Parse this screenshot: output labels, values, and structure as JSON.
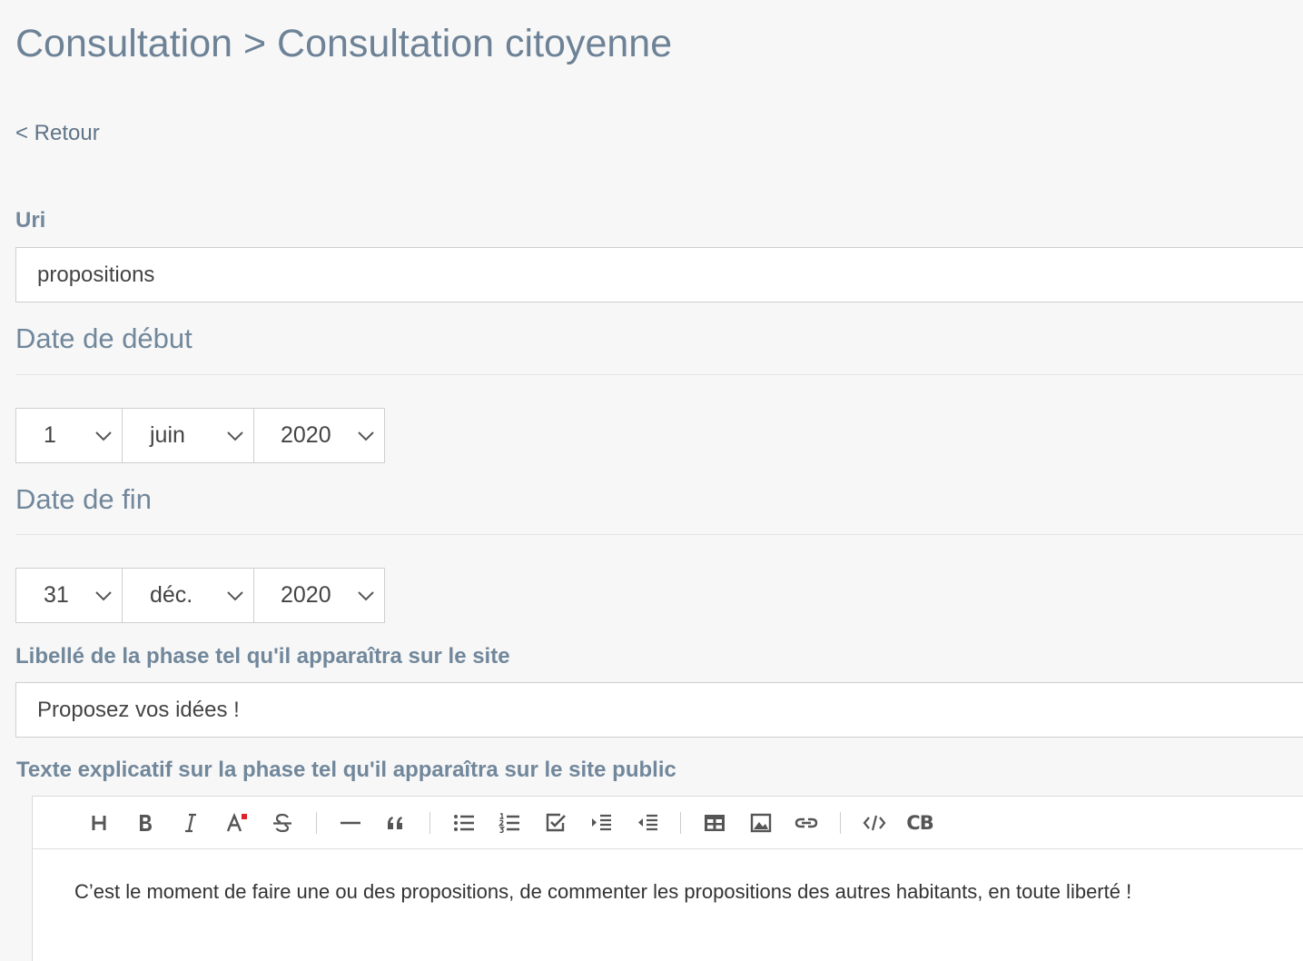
{
  "header": {
    "title": "Consultation > Consultation citoyenne",
    "back_label": "< Retour"
  },
  "form": {
    "uri": {
      "label": "Uri",
      "value": "propositions"
    },
    "start_date": {
      "title": "Date de début",
      "day": "1",
      "month": "juin",
      "year": "2020"
    },
    "end_date": {
      "title": "Date de fin",
      "day": "31",
      "month": "déc.",
      "year": "2020"
    },
    "phase_label": {
      "label": "Libellé de la phase tel qu'il apparaîtra sur le site",
      "value": "Proposez vos idées !"
    },
    "phase_text": {
      "label": "Texte explicatif sur la phase tel qu'il apparaîtra sur le site public",
      "toolbar": [
        "heading-icon",
        "bold-icon",
        "italic-icon",
        "text-color-icon",
        "strikethrough-icon",
        "horizontal-rule-icon",
        "quote-icon",
        "bullet-list-icon",
        "ordered-list-icon",
        "task-list-icon",
        "indent-icon",
        "outdent-icon",
        "table-icon",
        "image-icon",
        "link-icon",
        "code-icon",
        "codeblock-icon"
      ],
      "codeblock_label": "CB",
      "content": "C’est le moment de faire une ou des propositions, de commenter les propositions des autres habitants, en toute liberté !"
    }
  },
  "colors": {
    "background": "#f7f7f7",
    "title": "#6d8296",
    "label": "#71879b",
    "icon": "#555555",
    "text_color_accent": "#e0202a"
  }
}
